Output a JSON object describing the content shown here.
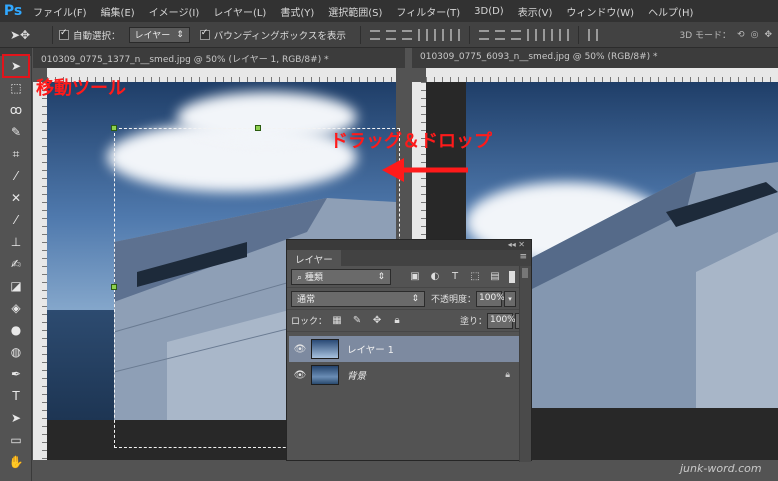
{
  "app": {
    "logo": "Ps"
  },
  "menu": [
    "ファイル(F)",
    "編集(E)",
    "イメージ(I)",
    "レイヤー(L)",
    "書式(Y)",
    "選択範囲(S)",
    "フィルター(T)",
    "3D(D)",
    "表示(V)",
    "ウィンドウ(W)",
    "ヘルプ(H)"
  ],
  "options": {
    "auto_select_label": "自動選択：",
    "auto_select_value": "レイヤー",
    "bounding_box_label": "バウンディングボックスを表示",
    "mode_3d_label": "3D モード："
  },
  "documents": [
    {
      "tab": "010309_0775_1377_n__smed.jpg @ 50% (レイヤー 1, RGB/8#) *"
    },
    {
      "tab": "010309_0775_6093_n__smed.jpg @ 50% (RGB/8#) *"
    }
  ],
  "layers_panel": {
    "tab": "レイヤー",
    "filter_label": "種類",
    "blend_mode": "通常",
    "opacity_label": "不透明度：",
    "opacity_value": "100%",
    "lock_label": "ロック：",
    "fill_label": "塗り：",
    "fill_value": "100%",
    "layers": [
      {
        "name": "レイヤー 1",
        "selected": true,
        "locked": false
      },
      {
        "name": "背景",
        "selected": false,
        "locked": true
      }
    ]
  },
  "annotations": {
    "move_tool": "移動ツール",
    "drag_drop": "ドラッグ＆ドロップ"
  },
  "watermark": "junk-word.com",
  "colors": {
    "annotation": "#ff1a1a",
    "selected_layer": "#7d8aa0",
    "ps_logo": "#31a8ff"
  }
}
